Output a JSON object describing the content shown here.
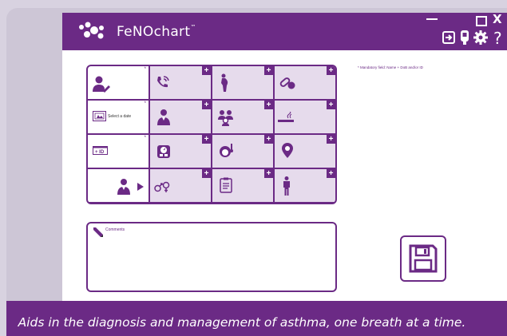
{
  "app": {
    "name": "FeNOchart",
    "trademark": "™",
    "brand_color": "#6b2a85",
    "cell_color": "#e6dbec"
  },
  "window_controls": {
    "minimize_icon": "minimize-icon",
    "maximize_icon": "maximize-icon",
    "close_label": "X"
  },
  "toolbar": {
    "icons": [
      "exit-icon",
      "device-icon",
      "gear-icon"
    ],
    "help_label": "?"
  },
  "patient_grid": {
    "rows": [
      {
        "left_icon": "user-edit-icon",
        "required": "*",
        "cells": [
          "phone-icon",
          "pregnant-icon",
          "pills-icon"
        ]
      },
      {
        "left_icon": "calendar-icon",
        "left_label": "Select a date",
        "required": "*",
        "cells": [
          "doctor-icon",
          "family-icon",
          "smoking-icon"
        ]
      },
      {
        "left_icon": "id-card-icon",
        "required": "*",
        "cells": [
          "scale-icon",
          "thermometer-head-icon",
          "location-pin-icon"
        ]
      },
      {
        "left_icon": "doctor-select-icon",
        "cells": [
          "gender-icon",
          "clipboard-icon",
          "standing-person-icon"
        ]
      }
    ],
    "add_label": "+"
  },
  "mandatory_note": "* Mandatory field: Name + DoB and/or ID",
  "comments": {
    "icon": "pencil-icon",
    "label": "Comments"
  },
  "save": {
    "icon": "floppy-disk-icon"
  },
  "footer": {
    "tagline": "Aids in the diagnosis and management of asthma, one breath at a time."
  }
}
